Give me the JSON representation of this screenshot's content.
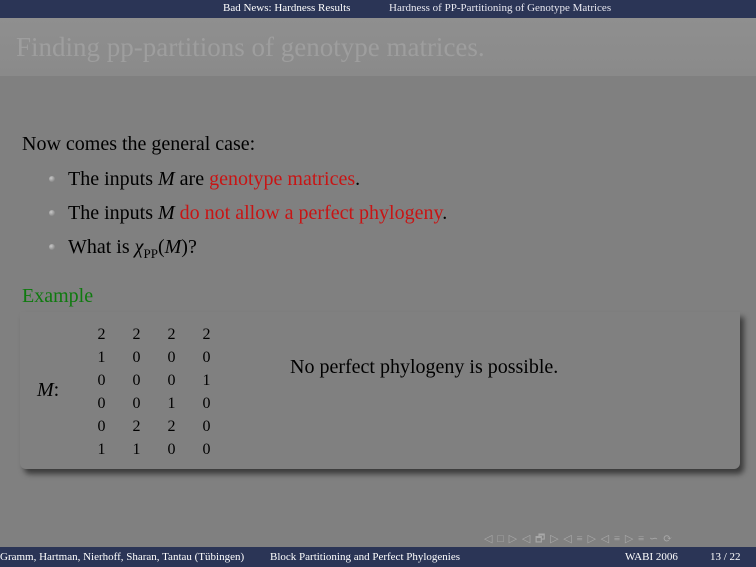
{
  "header": {
    "section": "Bad News: Hardness Results",
    "subsection": "Hardness of PP-Partitioning of Genotype Matrices"
  },
  "slide": {
    "title": "Finding pp-partitions of genotype matrices.",
    "intro": "Now comes the general case:",
    "items": [
      {
        "pre": "The inputs ",
        "var": "M",
        "mid": " are ",
        "highlight": "genotype matrices",
        "post": "."
      },
      {
        "pre": "The inputs ",
        "var": "M",
        "mid": " ",
        "highlight": "do not allow a perfect phylogeny",
        "post": "."
      },
      {
        "pre": "What is ",
        "chi": "χ",
        "sub": "PP",
        "open": "(",
        "var": "M",
        "close": ")?"
      }
    ],
    "example": {
      "heading": "Example",
      "matrix_label": "M",
      "matrix_colon": ":",
      "matrix": [
        [
          "2",
          "2",
          "2",
          "2"
        ],
        [
          "1",
          "0",
          "0",
          "0"
        ],
        [
          "0",
          "0",
          "0",
          "1"
        ],
        [
          "0",
          "0",
          "1",
          "0"
        ],
        [
          "0",
          "2",
          "2",
          "0"
        ],
        [
          "1",
          "1",
          "0",
          "0"
        ]
      ],
      "statement": "No perfect phylogeny is possible."
    }
  },
  "navigation": {
    "symbols": "◁ □ ▷ ◁ 🗗 ▷ ◁ ≡ ▷ ◁ ≡ ▷ ≡ ∽ ⟳"
  },
  "footer": {
    "authors": "Gramm, Hartman, Nierhoff, Sharan, Tantau (Tübingen)",
    "talk_title": "Block Partitioning and Perfect Phylogenies",
    "conference": "WABI 2006",
    "page": "13 / 22"
  },
  "colors": {
    "background": "#808080",
    "bar": "#2b3556",
    "highlight": "#c81414",
    "example_heading": "#0e7a0e"
  }
}
